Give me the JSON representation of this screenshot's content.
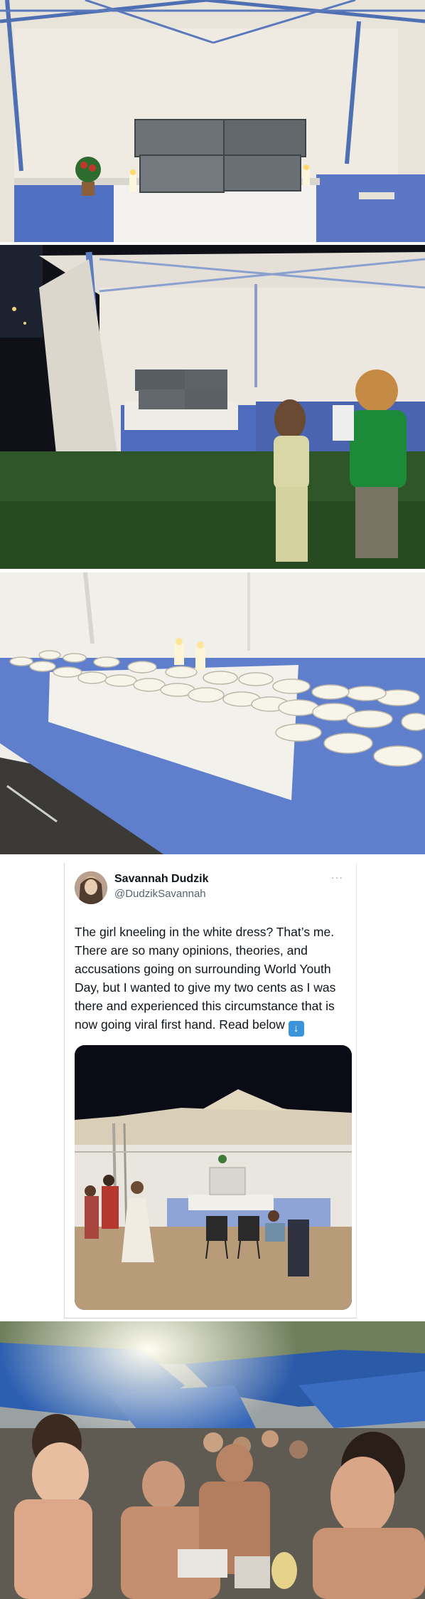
{
  "tweet": {
    "display_name": "Savannah Dudzik",
    "handle": "@DudzikSavannah",
    "more_glyph": "···",
    "body_text": "The girl kneeling in the white dress? That’s me. There are so many opinions, theories, and accusations going on surrounding World Youth Day, but I wanted to give my two cents as I was there and experienced this circumstance that is now going viral first hand. Read below",
    "emoji": "arrow-down-emoji"
  },
  "icons": {
    "tweet_more": "more-horizontal-icon",
    "tweet_emoji": "down-arrow-emoji-icon"
  },
  "colors": {
    "tent_white": "#f2efe8",
    "table_blue": "#5a78c8",
    "grass_green": "#2f5a26",
    "night_sky": "#0b0b16",
    "tarp_blue": "#2c5fb0"
  }
}
